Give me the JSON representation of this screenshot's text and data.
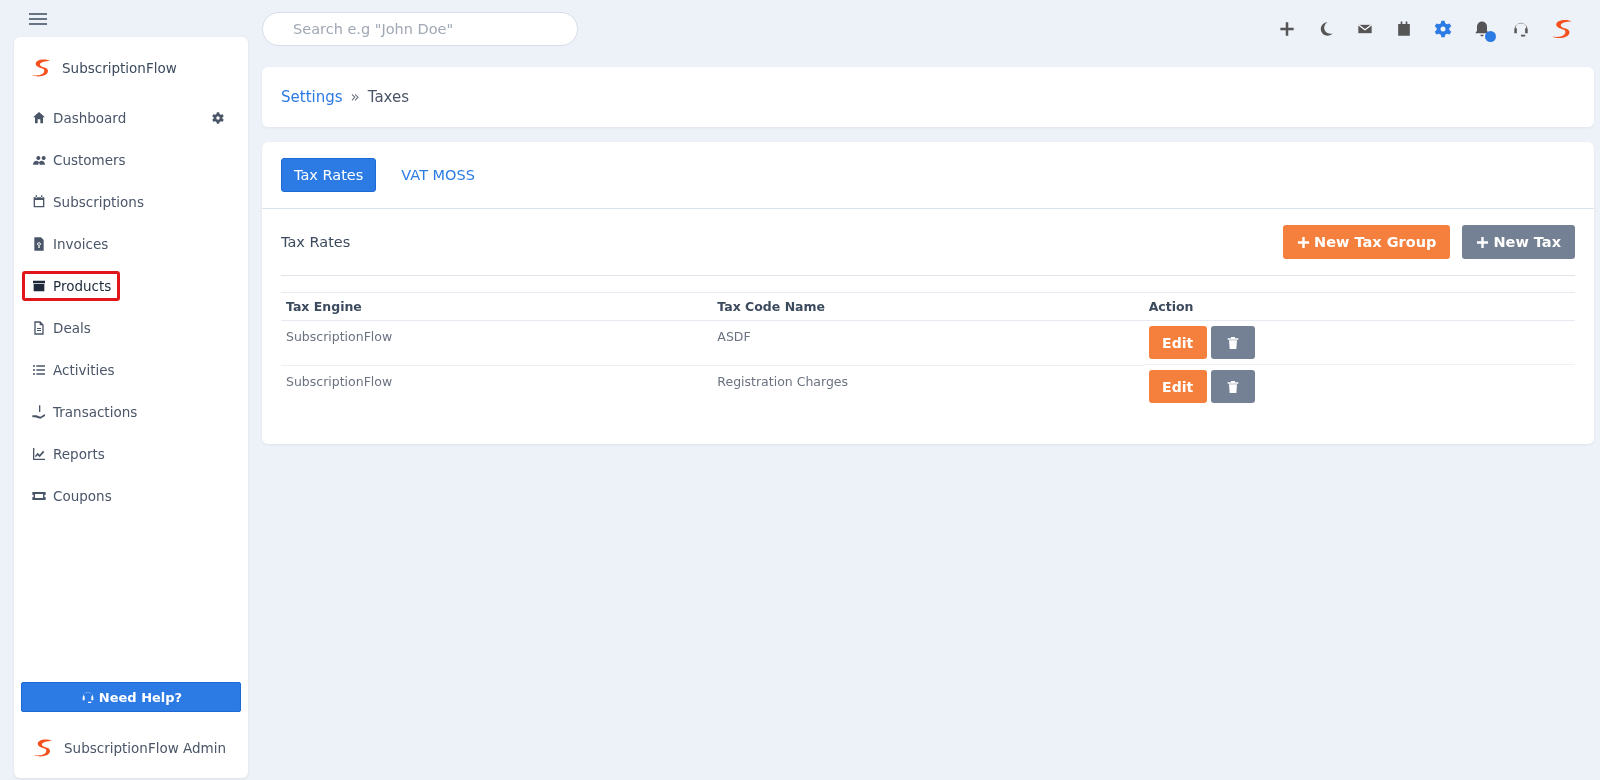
{
  "brand": {
    "name": "SubscriptionFlow"
  },
  "sidebar": {
    "items": [
      {
        "label": "Dashboard",
        "highlighted": false
      },
      {
        "label": "Customers",
        "highlighted": false
      },
      {
        "label": "Subscriptions",
        "highlighted": false
      },
      {
        "label": "Invoices",
        "highlighted": false
      },
      {
        "label": "Products",
        "highlighted": true
      },
      {
        "label": "Deals",
        "highlighted": false
      },
      {
        "label": "Activities",
        "highlighted": false
      },
      {
        "label": "Transactions",
        "highlighted": false
      },
      {
        "label": "Reports",
        "highlighted": false
      },
      {
        "label": "Coupons",
        "highlighted": false
      }
    ],
    "help_button": "Need Help?",
    "footer": "SubscriptionFlow Admin"
  },
  "search": {
    "placeholder": "Search e.g \"John Doe\""
  },
  "notifications": {
    "unread": true
  },
  "breadcrumb": {
    "link": "Settings",
    "separator": "»",
    "current": "Taxes"
  },
  "tabs": [
    {
      "label": "Tax Rates",
      "selected": true
    },
    {
      "label": "VAT MOSS",
      "selected": false
    }
  ],
  "section": {
    "title": "Tax Rates",
    "buttons": [
      {
        "label": "New Tax Group",
        "kind": "primary"
      },
      {
        "label": "New Tax",
        "kind": "secondary"
      }
    ]
  },
  "table": {
    "columns": [
      "Tax Engine",
      "Tax Code Name",
      "Action"
    ],
    "rows": [
      {
        "tax_engine": "SubscriptionFlow",
        "tax_code_name": "ASDF",
        "edit": "Edit"
      },
      {
        "tax_engine": "SubscriptionFlow",
        "tax_code_name": "Registration Charges",
        "edit": "Edit"
      }
    ]
  }
}
